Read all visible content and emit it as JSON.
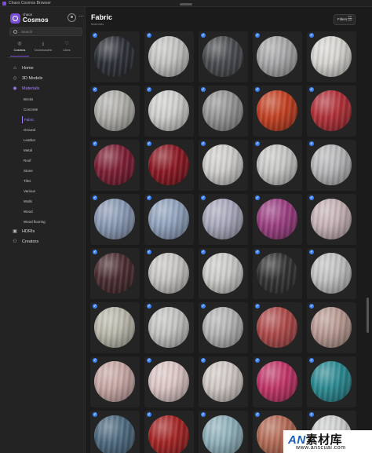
{
  "window": {
    "title": "Chaos Cosmos Browser"
  },
  "brand": {
    "small": "chaos",
    "name": "Cosmos"
  },
  "search": {
    "placeholder": "Search"
  },
  "top_tabs": [
    {
      "label": "Cosmos",
      "icon": "planet-icon",
      "active": true
    },
    {
      "label": "Downloaded",
      "icon": "download-icon",
      "active": false
    },
    {
      "label": "Likes",
      "icon": "heart-icon",
      "active": false
    }
  ],
  "nav": {
    "home": "Home",
    "models": "3D Models",
    "materials": "Materials",
    "hdris": "HDRIs",
    "creators": "Creators"
  },
  "materials_sub": [
    "Bricks",
    "Concrete",
    "Fabric",
    "Ground",
    "Leather",
    "Metal",
    "Roof",
    "Stone",
    "Tiles",
    "Various",
    "Walls",
    "Wood",
    "Wood flooring"
  ],
  "active_sub": "Fabric",
  "header": {
    "title": "Fabric",
    "subtitle": "Materials",
    "filters_label": "Filters"
  },
  "watermark": {
    "an": "AN",
    "name": "素材库",
    "url": "www.anscuai.com"
  },
  "colors": {
    "accent": "#7a4fd6",
    "accent_text": "#a682ff",
    "check": "#3c82f6",
    "materials": [
      [
        "#2d3038",
        "#c4c4c2",
        "#4a4c50",
        "#a9a9ab",
        "#d7d6d2"
      ],
      [
        "#b0afab",
        "#cfcfcd",
        "#959595",
        "#c54022",
        "#b23038"
      ],
      [
        "#7e1e34",
        "#8c1822",
        "#cfcecb",
        "#c8c9c6",
        "#b8b8ba"
      ],
      [
        "#8a9ab5",
        "#91a3be",
        "#a8a9bc",
        "#9c3e82",
        "#c7b3b6"
      ],
      [
        "#4a2c30",
        "#c8c6c4",
        "#cbcbc8",
        "#333334",
        "#c2c2c2"
      ],
      [
        "#bbb9ac",
        "#c3c4c2",
        "#b4b4b4",
        "#b04a4a",
        "#b99a92"
      ],
      [
        "#c8a8a5",
        "#dcc6c5",
        "#d0c8c4",
        "#c23468",
        "#2a8a92"
      ],
      [
        "#4d6a80",
        "#a52424",
        "#8fb0ba",
        "#b46a54",
        "#cfd0d0"
      ]
    ]
  }
}
